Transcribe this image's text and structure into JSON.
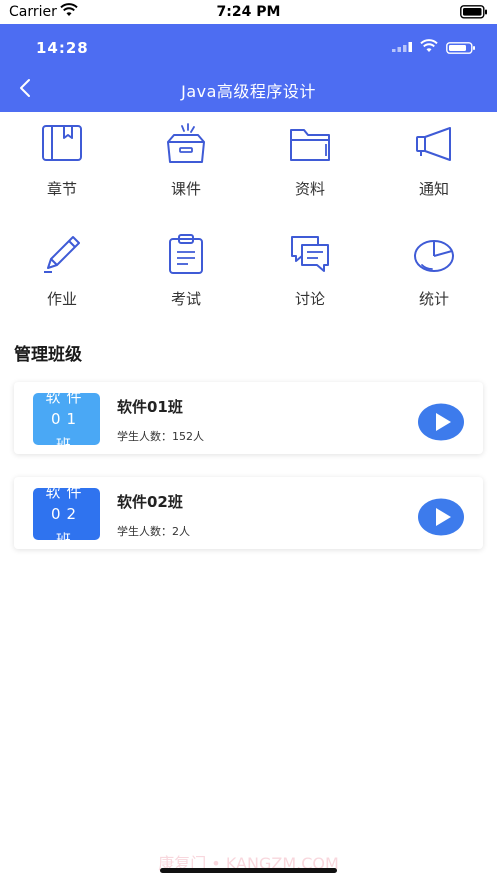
{
  "status_bar": {
    "carrier": "Carrier",
    "time": "7:24 PM"
  },
  "header": {
    "inner_time": "14:28",
    "title": "Java高级程序设计",
    "accent": "#4d6df2"
  },
  "grid": {
    "items": [
      {
        "label": "章节",
        "icon": "book-icon"
      },
      {
        "label": "课件",
        "icon": "open-box-icon"
      },
      {
        "label": "资料",
        "icon": "folder-icon"
      },
      {
        "label": "通知",
        "icon": "megaphone-icon"
      },
      {
        "label": "作业",
        "icon": "pencil-icon"
      },
      {
        "label": "考试",
        "icon": "clipboard-icon"
      },
      {
        "label": "讨论",
        "icon": "chat-bubbles-icon"
      },
      {
        "label": "统计",
        "icon": "pie-chart-icon"
      }
    ]
  },
  "section": {
    "title": "管理班级"
  },
  "classes": [
    {
      "thumb_line1": "软件",
      "thumb_line2": "01",
      "thumb_line3": "班",
      "name": "软件01班",
      "count_label": "学生人数：",
      "count_value": "152人",
      "thumb_color": "#4aa8f5"
    },
    {
      "thumb_line1": "软件",
      "thumb_line2": "02",
      "thumb_line3": "班",
      "name": "软件02班",
      "count_label": "学生人数：",
      "count_value": "2人",
      "thumb_color": "#2f73ef"
    }
  ],
  "watermark": "康复门 • KANGZM.COM"
}
